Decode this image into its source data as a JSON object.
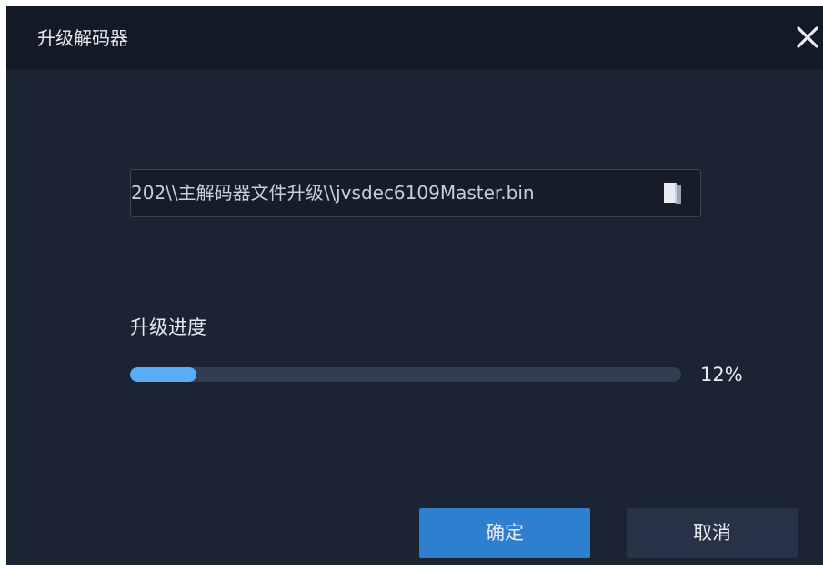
{
  "dialog": {
    "title": "升级解码器",
    "close_icon": "close-icon"
  },
  "file_field": {
    "value": "202\\\\主解码器文件升级\\\\jvsdec6109Master.bin",
    "icon": "folder-browse-icon"
  },
  "progress": {
    "label": "升级进度",
    "percent": 12,
    "value_text": "12%"
  },
  "buttons": {
    "ok_label": "确定",
    "cancel_label": "取消"
  },
  "colors": {
    "accent": "#2f7fd1",
    "progress_fill": "#58aef6",
    "background": "#1b2433"
  }
}
